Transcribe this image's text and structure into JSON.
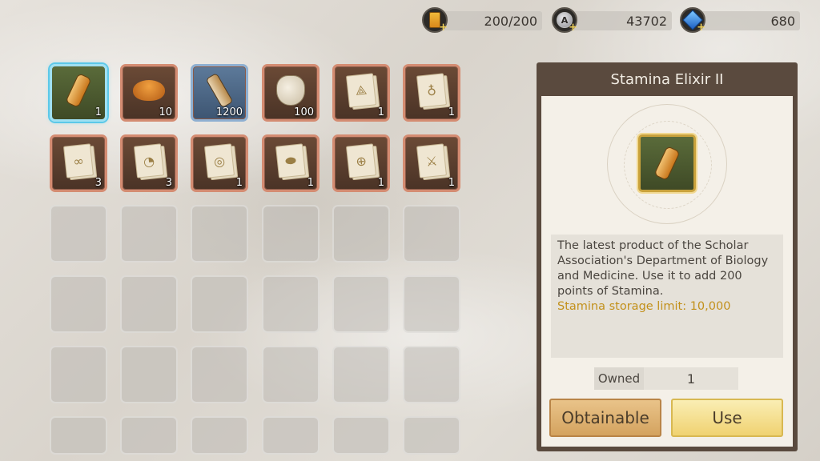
{
  "currencies": {
    "stamina": {
      "value": "200/200",
      "icon": "stamina-icon"
    },
    "gold": {
      "value": "43702",
      "icon": "gold-coin-icon"
    },
    "gems": {
      "value": "680",
      "icon": "blue-gem-icon"
    }
  },
  "inventory": {
    "items": [
      {
        "name": "stamina-elixir",
        "icon": "elixir-bottle-icon",
        "qty": "1"
      },
      {
        "name": "croissant",
        "icon": "croissant-icon",
        "qty": "10"
      },
      {
        "name": "flask",
        "icon": "flask-icon",
        "qty": "1200"
      },
      {
        "name": "sack",
        "icon": "sack-icon",
        "qty": "100"
      },
      {
        "name": "blueprint-compass",
        "icon": "blueprint-compass-icon",
        "qty": "1"
      },
      {
        "name": "blueprint-bulb",
        "icon": "blueprint-bulb-icon",
        "qty": "1"
      },
      {
        "name": "blueprint-binoculars",
        "icon": "blueprint-binoculars-icon",
        "qty": "3"
      },
      {
        "name": "blueprint-clock",
        "icon": "blueprint-clock-icon",
        "qty": "3"
      },
      {
        "name": "blueprint-target",
        "icon": "blueprint-target-icon",
        "qty": "1"
      },
      {
        "name": "blueprint-fish",
        "icon": "blueprint-fish-icon",
        "qty": "1"
      },
      {
        "name": "blueprint-globe",
        "icon": "blueprint-globe-icon",
        "qty": "1"
      },
      {
        "name": "blueprint-sword",
        "icon": "blueprint-sword-icon",
        "qty": "1"
      }
    ]
  },
  "detail": {
    "title": "Stamina Elixir II",
    "description": "The latest product of the Scholar Association's Department of Biology and Medicine. Use it to add 200 points of Stamina.",
    "highlight": "Stamina storage limit: 10,000",
    "owned_label": "Owned",
    "owned_value": "1",
    "obtain_button": "Obtainable",
    "use_button": "Use"
  },
  "colors": {
    "panel_frame": "#5a4a3e",
    "highlight_text": "#c2901a",
    "selected_border": "#9fe0f2"
  }
}
